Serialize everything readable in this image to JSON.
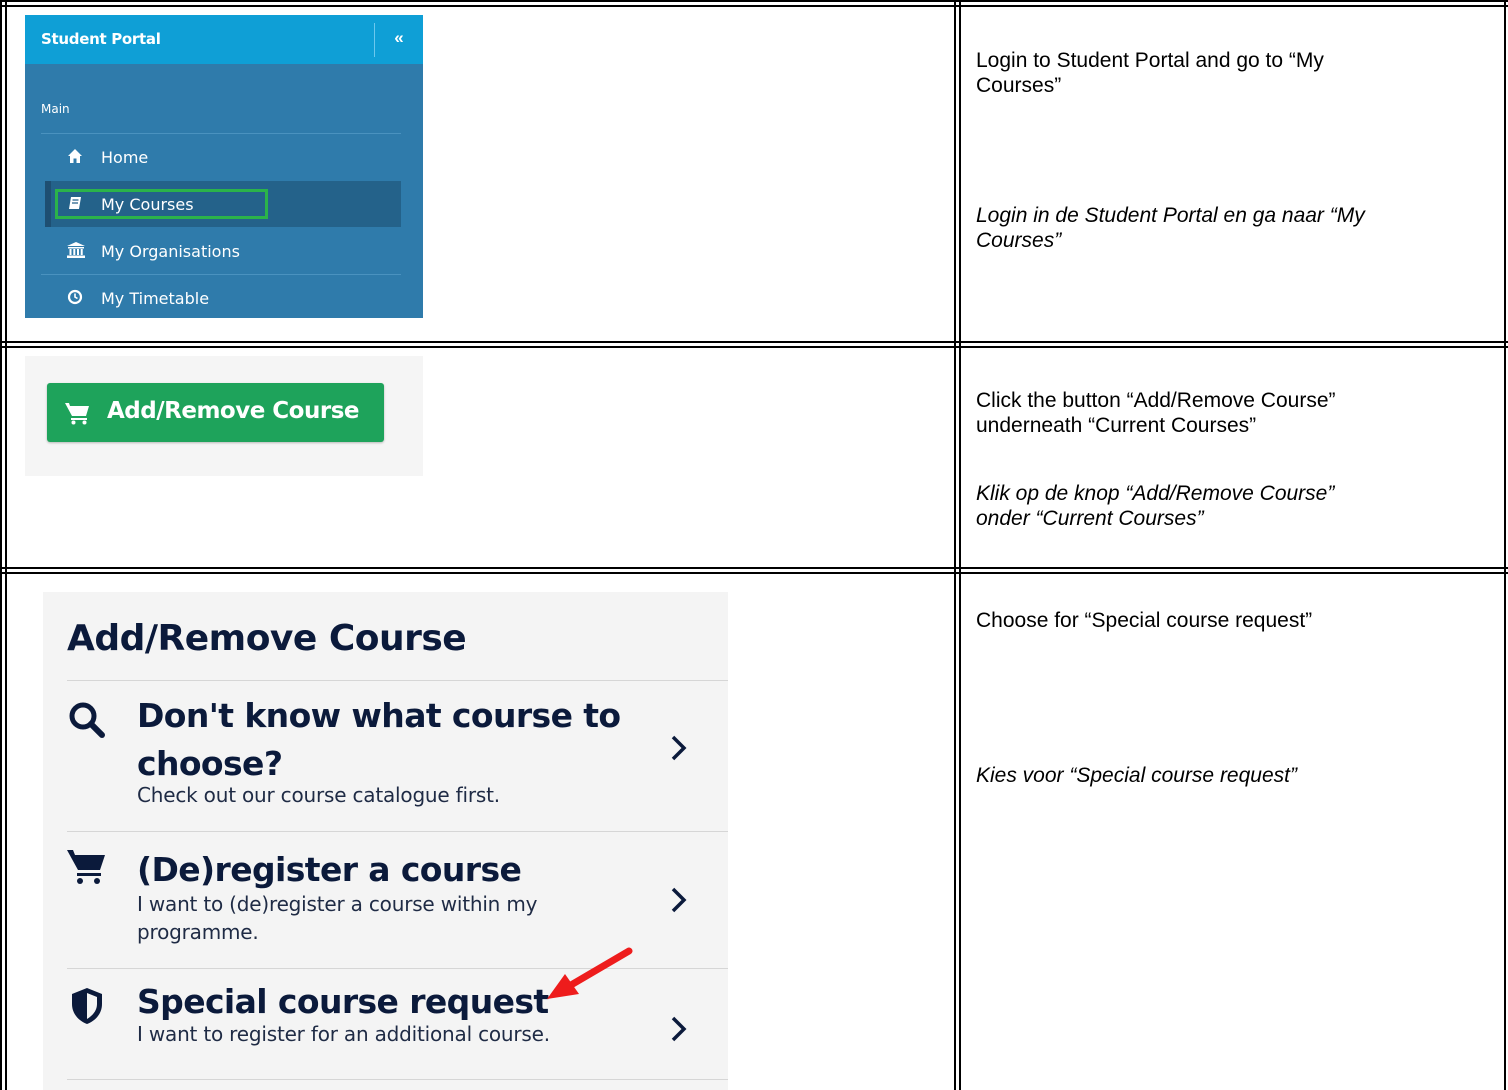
{
  "portal": {
    "title": "Student Portal",
    "collapse_glyph": "«",
    "section_label": "Main",
    "items": [
      {
        "label": "Home",
        "icon": "home-icon",
        "glyph": "🏠"
      },
      {
        "label": "My Courses",
        "icon": "book-icon",
        "glyph": "▰"
      },
      {
        "label": "My Organisations",
        "icon": "institution-icon",
        "glyph": "🏛"
      },
      {
        "label": "My Timetable",
        "icon": "clock-icon",
        "glyph": "◷"
      }
    ],
    "active_item": "My Courses",
    "highlight_color": "#2bb34a"
  },
  "add_button": {
    "label": "Add/Remove Course",
    "icon": "cart-icon",
    "color": "#1ea35b"
  },
  "course_panel": {
    "title": "Add/Remove Course",
    "options": [
      {
        "heading_line1": "Don't know what course to",
        "heading_line2": "choose?",
        "subtitle": "Check out our course catalogue first.",
        "icon": "search-icon"
      },
      {
        "heading_line1": "(De)register a course",
        "subtitle_line1": "I want to (de)register a course within my",
        "subtitle_line2": "programme.",
        "icon": "cart-icon"
      },
      {
        "heading_line1": "Special course request",
        "subtitle": "I want to register for an additional course.",
        "icon": "shield-icon"
      }
    ],
    "pointer_color": "#ee1c1c"
  },
  "instructions": {
    "step1_en_line1": "Login to Student Portal and go to “My",
    "step1_en_line2": "Courses”",
    "step1_nl_line1": "Login in de Student Portal en ga naar “My",
    "step1_nl_line2": "Courses”",
    "step2_en_line1": "Click the button “Add/Remove Course”",
    "step2_en_line2": "underneath “Current Courses”",
    "step2_nl_line1": "Klik op de knop “Add/Remove Course”",
    "step2_nl_line2": "onder “Current Courses”",
    "step3_en": "Choose for “Special course request”",
    "step3_nl": "Kies voor “Special course request”"
  }
}
